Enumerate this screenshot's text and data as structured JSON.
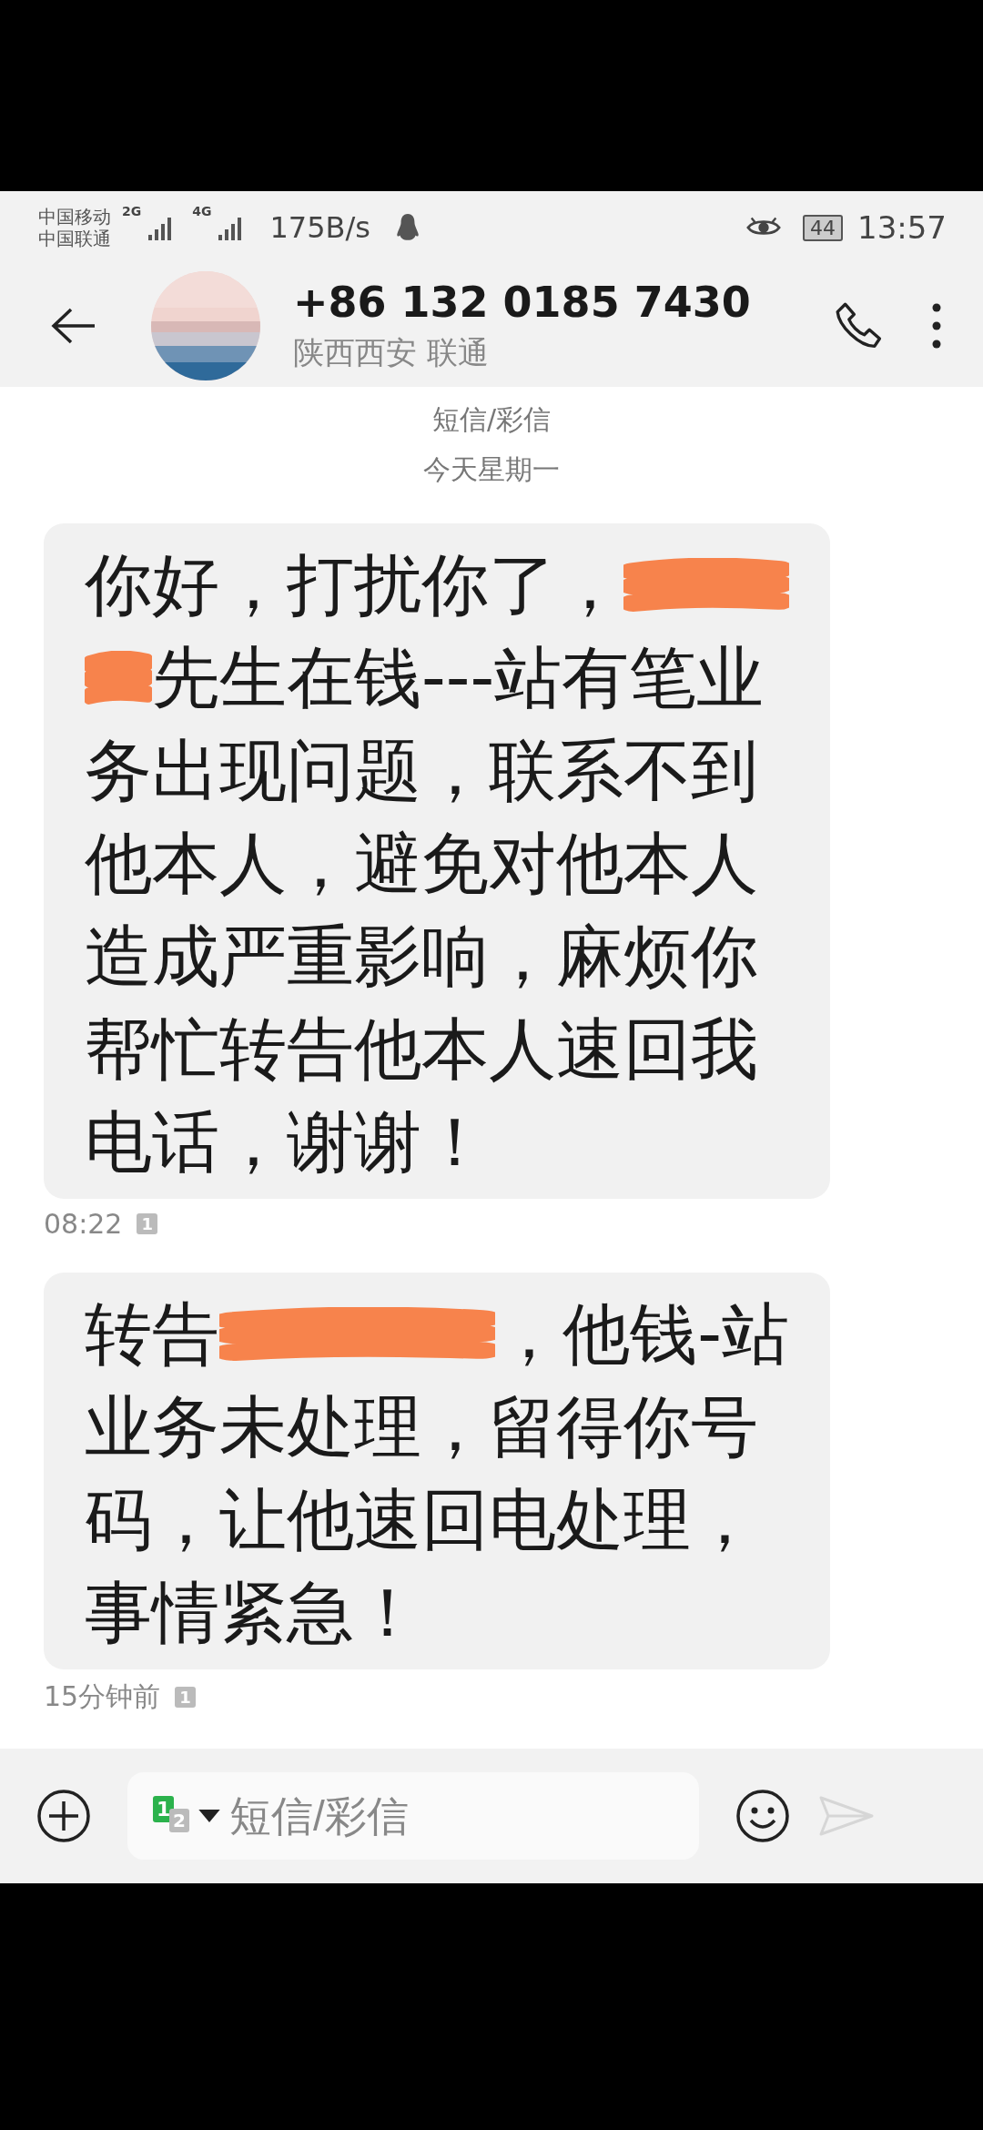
{
  "status_bar": {
    "carriers": [
      "中国移动",
      "中国联通"
    ],
    "networks": [
      "2G",
      "4G"
    ],
    "speed": "175B/s",
    "battery": "44",
    "time": "13:57"
  },
  "header": {
    "number": "+86 132 0185 7430",
    "location": "陕西西安 联通"
  },
  "thread_label": "短信/彩信",
  "day_label": "今天星期一",
  "messages": [
    {
      "lines": [
        [
          {
            "kind": "text",
            "text": "你好，打扰你了，"
          },
          {
            "kind": "redaction"
          }
        ],
        [
          {
            "kind": "redaction"
          },
          {
            "kind": "text",
            "text": "先生在钱---站有笔业"
          }
        ],
        [
          {
            "kind": "text",
            "text": "务出现问题，联系不到"
          }
        ],
        [
          {
            "kind": "text",
            "text": "他本人，避免对他本人"
          }
        ],
        [
          {
            "kind": "text",
            "text": "造成严重影响，麻烦你"
          }
        ],
        [
          {
            "kind": "text",
            "text": "帮忙转告他本人速回我"
          }
        ],
        [
          {
            "kind": "text",
            "text": "电话，谢谢！"
          }
        ]
      ],
      "time": "08:22",
      "sim": "1"
    },
    {
      "lines": [
        [
          {
            "kind": "text",
            "text": "转告"
          },
          {
            "kind": "redaction"
          },
          {
            "kind": "text",
            "text": "，他钱-站"
          }
        ],
        [
          {
            "kind": "text",
            "text": "业务未处理，留得你号"
          }
        ],
        [
          {
            "kind": "text",
            "text": "码，让他速回电处理，"
          }
        ],
        [
          {
            "kind": "text",
            "text": "事情紧急！"
          }
        ]
      ],
      "time": "15分钟前",
      "sim": "1"
    }
  ],
  "composer": {
    "sim_primary": "1",
    "sim_secondary": "2",
    "placeholder": "短信/彩信"
  }
}
